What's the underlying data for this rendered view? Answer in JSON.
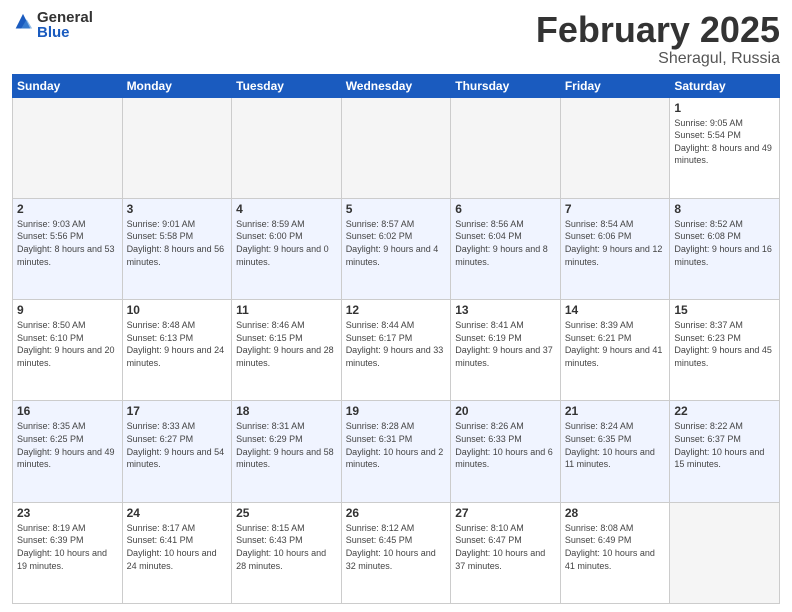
{
  "header": {
    "logo_general": "General",
    "logo_blue": "Blue",
    "title": "February 2025",
    "location": "Sheragul, Russia"
  },
  "days_of_week": [
    "Sunday",
    "Monday",
    "Tuesday",
    "Wednesday",
    "Thursday",
    "Friday",
    "Saturday"
  ],
  "weeks": [
    [
      {
        "day": "",
        "info": ""
      },
      {
        "day": "",
        "info": ""
      },
      {
        "day": "",
        "info": ""
      },
      {
        "day": "",
        "info": ""
      },
      {
        "day": "",
        "info": ""
      },
      {
        "day": "",
        "info": ""
      },
      {
        "day": "1",
        "info": "Sunrise: 9:05 AM\nSunset: 5:54 PM\nDaylight: 8 hours and 49 minutes."
      }
    ],
    [
      {
        "day": "2",
        "info": "Sunrise: 9:03 AM\nSunset: 5:56 PM\nDaylight: 8 hours and 53 minutes."
      },
      {
        "day": "3",
        "info": "Sunrise: 9:01 AM\nSunset: 5:58 PM\nDaylight: 8 hours and 56 minutes."
      },
      {
        "day": "4",
        "info": "Sunrise: 8:59 AM\nSunset: 6:00 PM\nDaylight: 9 hours and 0 minutes."
      },
      {
        "day": "5",
        "info": "Sunrise: 8:57 AM\nSunset: 6:02 PM\nDaylight: 9 hours and 4 minutes."
      },
      {
        "day": "6",
        "info": "Sunrise: 8:56 AM\nSunset: 6:04 PM\nDaylight: 9 hours and 8 minutes."
      },
      {
        "day": "7",
        "info": "Sunrise: 8:54 AM\nSunset: 6:06 PM\nDaylight: 9 hours and 12 minutes."
      },
      {
        "day": "8",
        "info": "Sunrise: 8:52 AM\nSunset: 6:08 PM\nDaylight: 9 hours and 16 minutes."
      }
    ],
    [
      {
        "day": "9",
        "info": "Sunrise: 8:50 AM\nSunset: 6:10 PM\nDaylight: 9 hours and 20 minutes."
      },
      {
        "day": "10",
        "info": "Sunrise: 8:48 AM\nSunset: 6:13 PM\nDaylight: 9 hours and 24 minutes."
      },
      {
        "day": "11",
        "info": "Sunrise: 8:46 AM\nSunset: 6:15 PM\nDaylight: 9 hours and 28 minutes."
      },
      {
        "day": "12",
        "info": "Sunrise: 8:44 AM\nSunset: 6:17 PM\nDaylight: 9 hours and 33 minutes."
      },
      {
        "day": "13",
        "info": "Sunrise: 8:41 AM\nSunset: 6:19 PM\nDaylight: 9 hours and 37 minutes."
      },
      {
        "day": "14",
        "info": "Sunrise: 8:39 AM\nSunset: 6:21 PM\nDaylight: 9 hours and 41 minutes."
      },
      {
        "day": "15",
        "info": "Sunrise: 8:37 AM\nSunset: 6:23 PM\nDaylight: 9 hours and 45 minutes."
      }
    ],
    [
      {
        "day": "16",
        "info": "Sunrise: 8:35 AM\nSunset: 6:25 PM\nDaylight: 9 hours and 49 minutes."
      },
      {
        "day": "17",
        "info": "Sunrise: 8:33 AM\nSunset: 6:27 PM\nDaylight: 9 hours and 54 minutes."
      },
      {
        "day": "18",
        "info": "Sunrise: 8:31 AM\nSunset: 6:29 PM\nDaylight: 9 hours and 58 minutes."
      },
      {
        "day": "19",
        "info": "Sunrise: 8:28 AM\nSunset: 6:31 PM\nDaylight: 10 hours and 2 minutes."
      },
      {
        "day": "20",
        "info": "Sunrise: 8:26 AM\nSunset: 6:33 PM\nDaylight: 10 hours and 6 minutes."
      },
      {
        "day": "21",
        "info": "Sunrise: 8:24 AM\nSunset: 6:35 PM\nDaylight: 10 hours and 11 minutes."
      },
      {
        "day": "22",
        "info": "Sunrise: 8:22 AM\nSunset: 6:37 PM\nDaylight: 10 hours and 15 minutes."
      }
    ],
    [
      {
        "day": "23",
        "info": "Sunrise: 8:19 AM\nSunset: 6:39 PM\nDaylight: 10 hours and 19 minutes."
      },
      {
        "day": "24",
        "info": "Sunrise: 8:17 AM\nSunset: 6:41 PM\nDaylight: 10 hours and 24 minutes."
      },
      {
        "day": "25",
        "info": "Sunrise: 8:15 AM\nSunset: 6:43 PM\nDaylight: 10 hours and 28 minutes."
      },
      {
        "day": "26",
        "info": "Sunrise: 8:12 AM\nSunset: 6:45 PM\nDaylight: 10 hours and 32 minutes."
      },
      {
        "day": "27",
        "info": "Sunrise: 8:10 AM\nSunset: 6:47 PM\nDaylight: 10 hours and 37 minutes."
      },
      {
        "day": "28",
        "info": "Sunrise: 8:08 AM\nSunset: 6:49 PM\nDaylight: 10 hours and 41 minutes."
      },
      {
        "day": "",
        "info": ""
      }
    ]
  ]
}
